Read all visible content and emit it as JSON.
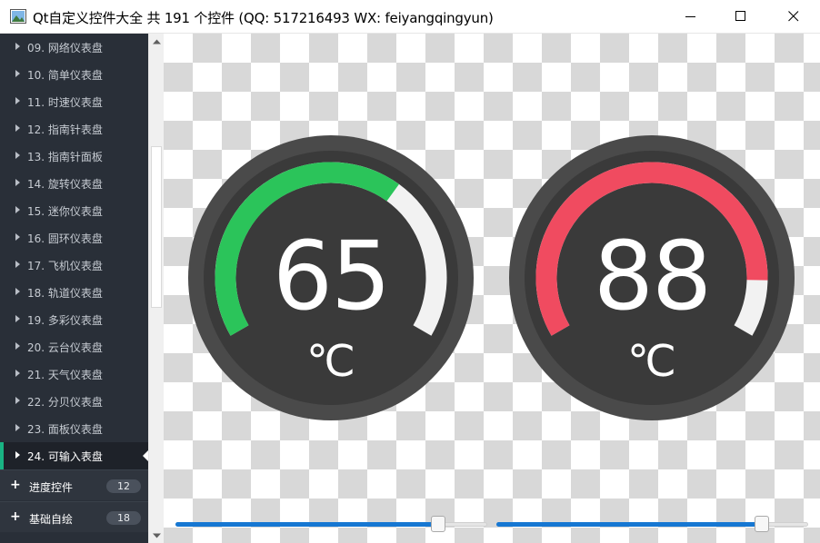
{
  "window": {
    "title": "Qt自定义控件大全 共 191 个控件 (QQ: 517216493 WX: feiyangqingyun)",
    "minimize_icon": "minimize-icon",
    "maximize_icon": "maximize-icon",
    "close_icon": "close-icon"
  },
  "sidebar": {
    "items": [
      {
        "label": "09. 网络仪表盘"
      },
      {
        "label": "10. 简单仪表盘"
      },
      {
        "label": "11. 时速仪表盘"
      },
      {
        "label": "12. 指南针表盘"
      },
      {
        "label": "13. 指南针面板"
      },
      {
        "label": "14. 旋转仪表盘"
      },
      {
        "label": "15. 迷你仪表盘"
      },
      {
        "label": "16. 圆环仪表盘"
      },
      {
        "label": "17. 飞机仪表盘"
      },
      {
        "label": "18. 轨道仪表盘"
      },
      {
        "label": "19. 多彩仪表盘"
      },
      {
        "label": "20. 云台仪表盘"
      },
      {
        "label": "21. 天气仪表盘"
      },
      {
        "label": "22. 分贝仪表盘"
      },
      {
        "label": "23. 面板仪表盘"
      },
      {
        "label": "24. 可输入表盘",
        "active": true
      }
    ],
    "groups": [
      {
        "label": "进度控件",
        "count": "12"
      },
      {
        "label": "基础自绘",
        "count": "18"
      }
    ]
  },
  "gauges": [
    {
      "value": "65",
      "unit": "℃",
      "fraction": 0.65,
      "color": "#2bc45a"
    },
    {
      "value": "88",
      "unit": "℃",
      "fraction": 0.88,
      "color": "#f04b60"
    }
  ],
  "sliders": [
    {
      "fraction": 0.86
    },
    {
      "fraction": 0.87
    }
  ],
  "colors": {
    "gauge_outer": "#4a4a4a",
    "gauge_inner": "#3a3a3a",
    "gauge_track": "#f2f2f2",
    "sidebar_bg": "#292f38",
    "accent": "#19b383",
    "slider_fill": "#1677d2"
  }
}
